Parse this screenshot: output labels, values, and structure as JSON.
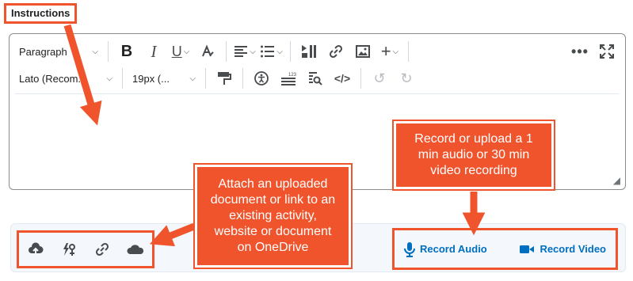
{
  "instructions_label": "Instructions",
  "toolbar": {
    "format_select": "Paragraph",
    "font_select": "Lato (Recom...",
    "size_select": "19px (..."
  },
  "bottom": {
    "record_audio": "Record Audio",
    "record_video": "Record Video"
  },
  "callouts": {
    "record_lines": [
      "Record or upload a 1",
      "min audio or 30 min",
      "video recording"
    ],
    "attach_lines": [
      "Attach an uploaded",
      "document or link to an",
      "existing activity,",
      "website or document",
      "on OneDrive"
    ]
  },
  "colors": {
    "accent_orange": "#f0542c",
    "link_blue": "#006fbf",
    "icon_grey": "#494c4e"
  }
}
